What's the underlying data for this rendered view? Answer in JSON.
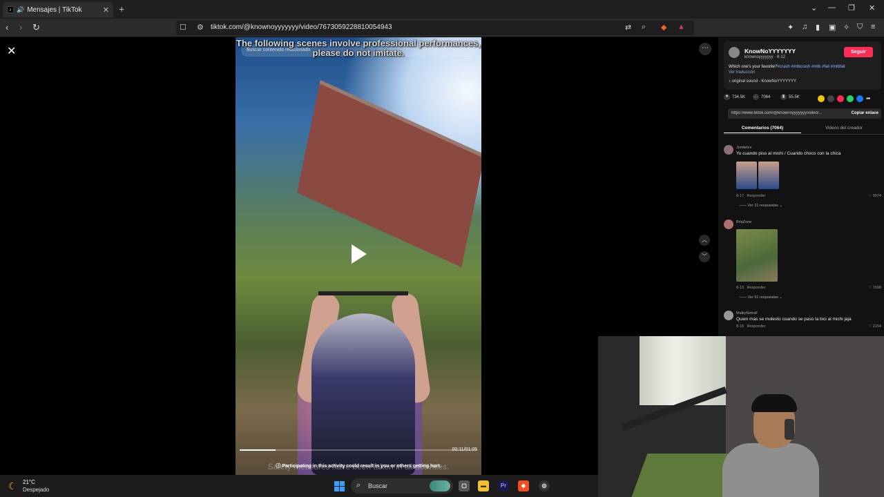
{
  "browser": {
    "tab_title": "Mensajes | TikTok",
    "url": "tiktok.com/@knownoyyyyyyy/video/7673059228810054943"
  },
  "video": {
    "search_placeholder": "Buscar contenido relacionado",
    "caption_top": "The following scenes involve professional performances, please do not imitate.",
    "time": "00:11/01:05",
    "progress": 0.15,
    "warning": "Participating in this activity could result in you or others getting hurt.",
    "subtitle": "Safety measures have been taken in all activities."
  },
  "panel": {
    "author_name": "KnowNoYYYYYYY",
    "author_handle": "knownoyyyyyyy · 8-12",
    "follow_label": "Seguir",
    "description": "Which one's your favorite?",
    "hashtags": "#crash #mtbcrash #mtb #fail #mtbfail",
    "translate_label": "Ver traducción",
    "sound": "original sound - KnowNoYYYYYYY",
    "likes": "734.5K",
    "comments_count": "7064",
    "saves": "55.5K",
    "link": "https://www.tiktok.com/@knownoyyyyyyy/video/...",
    "copy_label": "Copiar enlace",
    "tab_comments": "Comentarios (7064)",
    "tab_creator": "Videos del creador",
    "comments": [
      {
        "user": "Jordancv",
        "text": "Yo cuando piso al michi / Cuando choco con la chica",
        "date": "8-17",
        "reply": "Responder",
        "likes": "9974",
        "replies": "Ver 21 respuestas"
      },
      {
        "user": "BrlaZone",
        "text": "",
        "date": "8-13",
        "reply": "Responder",
        "likes": "1698",
        "replies": "Ver 51 respuestas"
      },
      {
        "user": "MalkyNetraF",
        "text": "Quien mas se molesto cuando se paso la bici al michi jaja",
        "date": "8-16",
        "reply": "Responder",
        "likes": "2154",
        "replies": ""
      }
    ]
  },
  "taskbar": {
    "temp": "21°C",
    "weather": "Despejado",
    "search_label": "Buscar"
  }
}
